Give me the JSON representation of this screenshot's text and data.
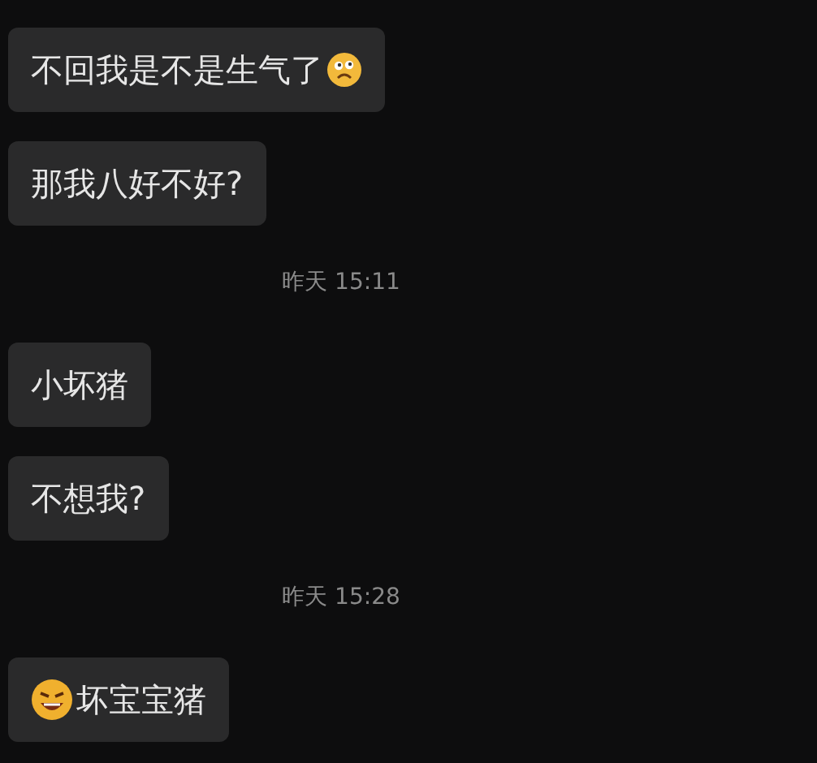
{
  "messages": [
    {
      "kind": "message",
      "parts": [
        {
          "kind": "text",
          "text": "不回我是不是生气了"
        },
        {
          "kind": "worried"
        }
      ]
    },
    {
      "kind": "message",
      "parts": [
        {
          "kind": "text",
          "text": "那我八好不好?"
        }
      ]
    },
    {
      "kind": "time",
      "text": "昨天 15:11"
    },
    {
      "kind": "message",
      "parts": [
        {
          "kind": "text",
          "text": "小坏猪"
        }
      ]
    },
    {
      "kind": "message",
      "parts": [
        {
          "kind": "text",
          "text": "不想我?"
        }
      ]
    },
    {
      "kind": "time",
      "text": "昨天 15:28"
    },
    {
      "kind": "message",
      "parts": [
        {
          "kind": "laughing"
        },
        {
          "kind": "text",
          "text": "坏宝宝猪"
        }
      ]
    }
  ]
}
